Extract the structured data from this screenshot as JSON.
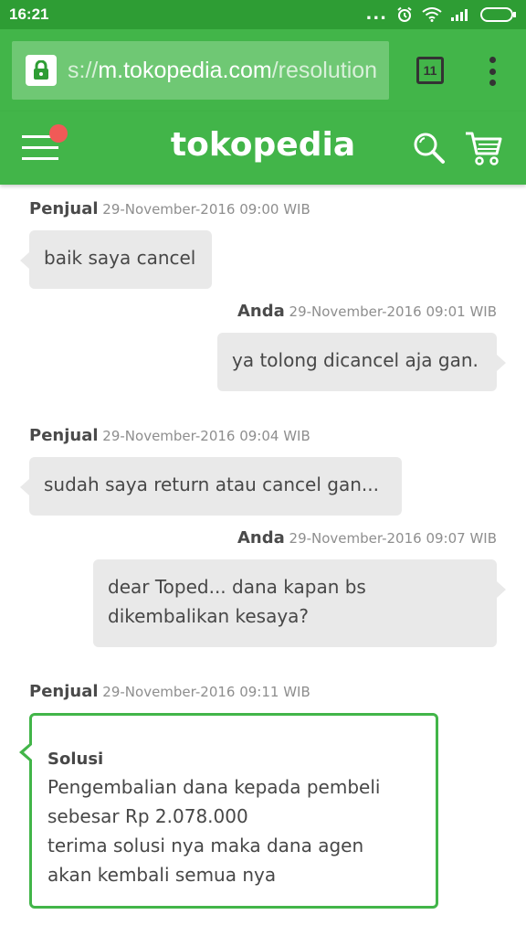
{
  "status_bar": {
    "time": "16:21"
  },
  "browser": {
    "url_scheme": "s://",
    "url_host": "m.tokopedia.com",
    "url_path": "/resolution",
    "tab_count": "11"
  },
  "app": {
    "brand": "tokopedia"
  },
  "messages": [
    {
      "author": "Penjual",
      "timestamp": "29-November-2016 09:00 WIB",
      "text": "baik saya cancel"
    },
    {
      "author": "Anda",
      "timestamp": "29-November-2016 09:01 WIB",
      "text": "ya tolong dicancel aja gan."
    },
    {
      "author": "Penjual",
      "timestamp": "29-November-2016 09:04 WIB",
      "text": "sudah saya return atau cancel gan..."
    },
    {
      "author": "Anda",
      "timestamp": "29-November-2016 09:07 WIB",
      "text_line1": "dear Toped... dana kapan bs",
      "text_line2": "dikembalikan kesaya?"
    },
    {
      "author": "Penjual",
      "timestamp": "29-November-2016 09:11 WIB"
    }
  ],
  "solusi": {
    "title": "Solusi",
    "line1": "Pengembalian dana kepada pembeli",
    "line2": "sebesar Rp 2.078.000",
    "line3": "terima solusi nya maka dana agen",
    "line4": "akan kembali semua nya"
  },
  "colors": {
    "status_bar": "#2e9d34",
    "brand_green": "#42b549",
    "bubble": "#e9e9e9",
    "notification": "#f05a57"
  }
}
